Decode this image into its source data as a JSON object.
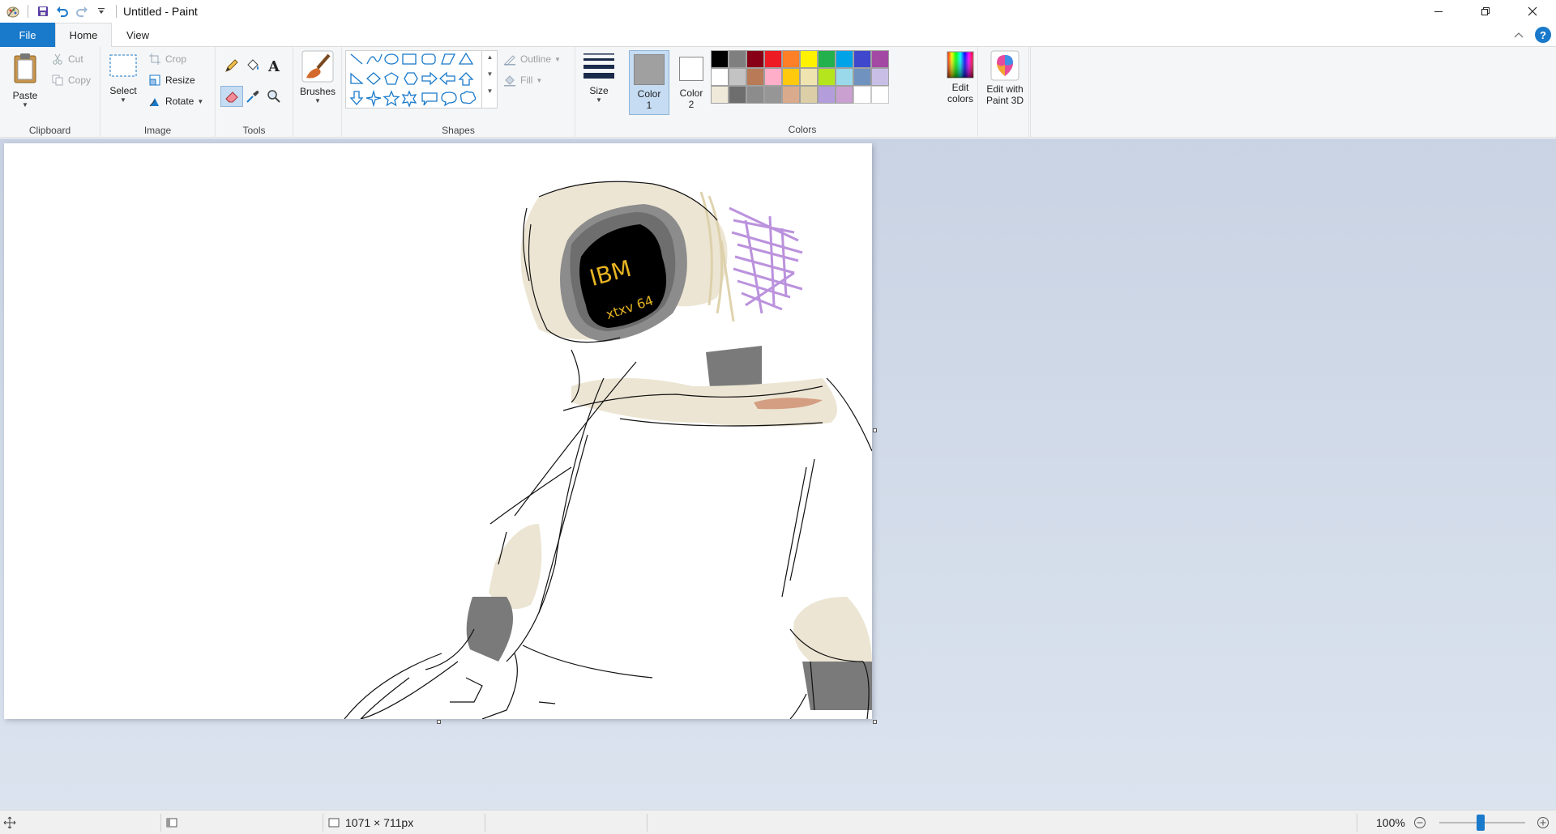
{
  "window": {
    "title": "Untitled - Paint"
  },
  "tabs": {
    "file": "File",
    "home": "Home",
    "view": "View"
  },
  "ribbon": {
    "clipboard": {
      "label": "Clipboard",
      "paste": "Paste",
      "cut": "Cut",
      "copy": "Copy"
    },
    "image": {
      "label": "Image",
      "select": "Select",
      "crop": "Crop",
      "resize": "Resize",
      "rotate": "Rotate"
    },
    "tools": {
      "label": "Tools"
    },
    "brushes": {
      "label": "Brushes"
    },
    "shapes": {
      "label": "Shapes",
      "outline": "Outline",
      "fill": "Fill"
    },
    "size": {
      "label": "Size"
    },
    "colors": {
      "label": "Colors",
      "color1_line1": "Color",
      "color1_line2": "1",
      "color2_line1": "Color",
      "color2_line2": "2",
      "edit_colors_line1": "Edit",
      "edit_colors_line2": "colors",
      "paint3d_line1": "Edit with",
      "paint3d_line2": "Paint 3D",
      "color1_value": "#a0a0a0",
      "color2_value": "#ffffff",
      "palette_row1": [
        "#000000",
        "#7f7f7f",
        "#880015",
        "#ed1c24",
        "#ff7f27",
        "#fff200",
        "#22b14c",
        "#00a2e8",
        "#3f48cc",
        "#a349a4"
      ],
      "palette_row2": [
        "#ffffff",
        "#c3c3c3",
        "#b97a57",
        "#ffaec9",
        "#ffc90e",
        "#efe4b0",
        "#b5e61d",
        "#99d9ea",
        "#7092be",
        "#c8bfe7"
      ],
      "palette_row3": [
        "#efe9d9",
        "#6e6e6e",
        "#8c8c8c",
        "#969696",
        "#d9ab8c",
        "#dccfa7",
        "#b39ddb",
        "#c9a0d0",
        "#ffffff",
        "#ffffff"
      ]
    }
  },
  "canvas": {
    "text_ibm": "IBM",
    "text_model": "xtxv 64"
  },
  "status": {
    "dimensions": "1071 × 711px",
    "zoom": "100%"
  }
}
